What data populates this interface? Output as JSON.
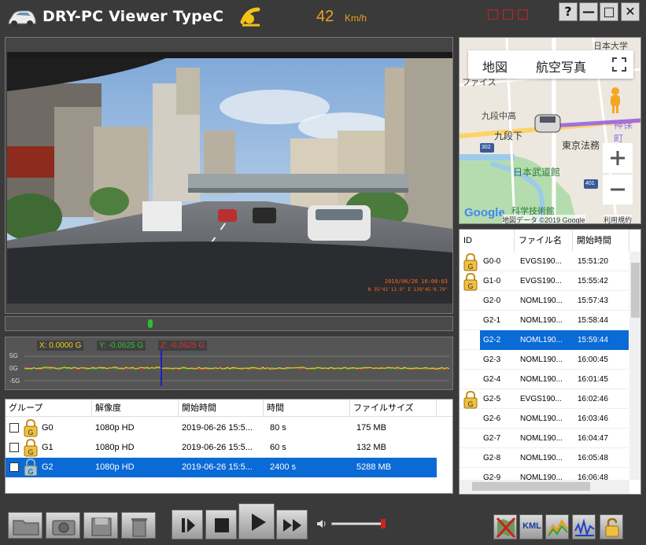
{
  "app": {
    "title": "DRY-PC Viewer TypeC",
    "speed_value": "42",
    "speed_unit": "Km/h"
  },
  "window_buttons": [
    "?",
    "—",
    "□",
    "✕"
  ],
  "video": {
    "timestamp": "2019/06/26 16:00:03",
    "coords": "N 35°41'13.9\" E 139°45'8.79\""
  },
  "gsensor": {
    "x_label": "X: 0.0000 G",
    "y_label": "Y: -0.0625 G",
    "z_label": "Z: -0.0625 G",
    "axis_top": "5G",
    "axis_mid": "0G",
    "axis_bottom": "-5G",
    "colors": {
      "x": "#f0d020",
      "y": "#30c030",
      "z": "#e03030"
    }
  },
  "groups": {
    "headers": [
      "グループ",
      "解像度",
      "開始時間",
      "時間",
      "ファイルサイズ"
    ],
    "rows": [
      {
        "name": "G0",
        "resolution": "1080p HD",
        "start": "2019-06-26 15:5...",
        "duration": "80 s",
        "size": "175 MB",
        "selected": false
      },
      {
        "name": "G1",
        "resolution": "1080p HD",
        "start": "2019-06-26 15:5...",
        "duration": "60 s",
        "size": "132 MB",
        "selected": false
      },
      {
        "name": "G2",
        "resolution": "1080p HD",
        "start": "2019-06-26 15:5...",
        "duration": "2400 s",
        "size": "5288 MB",
        "selected": true
      }
    ]
  },
  "map": {
    "tab_map": "地図",
    "tab_satellite": "航空写真",
    "attribution": "地図データ ©2019 Google",
    "terms": "利用規約",
    "google": "Google",
    "places": [
      "九段下",
      "東京法務",
      "日本武道館",
      "科学技術館",
      "神保町",
      "九段中高",
      "日本大学",
      "ファイス"
    ],
    "route_numbers": [
      "302",
      "401"
    ]
  },
  "files": {
    "headers": [
      "ID",
      "ファイル名",
      "開始時間"
    ],
    "rows": [
      {
        "id": "G0-0",
        "name": "EVGS190...",
        "time": "15:51:20",
        "locked": true,
        "selected": false
      },
      {
        "id": "G1-0",
        "name": "EVGS190...",
        "time": "15:55:42",
        "locked": true,
        "selected": false
      },
      {
        "id": "G2-0",
        "name": "NOML190...",
        "time": "15:57:43",
        "locked": false,
        "selected": false
      },
      {
        "id": "G2-1",
        "name": "NOML190...",
        "time": "15:58:44",
        "locked": false,
        "selected": false
      },
      {
        "id": "G2-2",
        "name": "NOML190...",
        "time": "15:59:44",
        "locked": false,
        "selected": true
      },
      {
        "id": "G2-3",
        "name": "NOML190...",
        "time": "16:00:45",
        "locked": false,
        "selected": false
      },
      {
        "id": "G2-4",
        "name": "NOML190...",
        "time": "16:01:45",
        "locked": false,
        "selected": false
      },
      {
        "id": "G2-5",
        "name": "EVGS190...",
        "time": "16:02:46",
        "locked": true,
        "selected": false
      },
      {
        "id": "G2-6",
        "name": "NOML190...",
        "time": "16:03:46",
        "locked": false,
        "selected": false
      },
      {
        "id": "G2-7",
        "name": "NOML190...",
        "time": "16:04:47",
        "locked": false,
        "selected": false
      },
      {
        "id": "G2-8",
        "name": "NOML190...",
        "time": "16:05:48",
        "locked": false,
        "selected": false
      },
      {
        "id": "G2-9",
        "name": "NOML190...",
        "time": "16:06:48",
        "locked": false,
        "selected": false
      }
    ]
  },
  "toolbar": {
    "kml_label": "KML"
  },
  "playback": {
    "seek_progress": 0.32,
    "volume": 0.9
  },
  "colors": {
    "selection": "#0a6ad6",
    "speed": "#f0a020",
    "timestamp": "#ff6a10"
  }
}
